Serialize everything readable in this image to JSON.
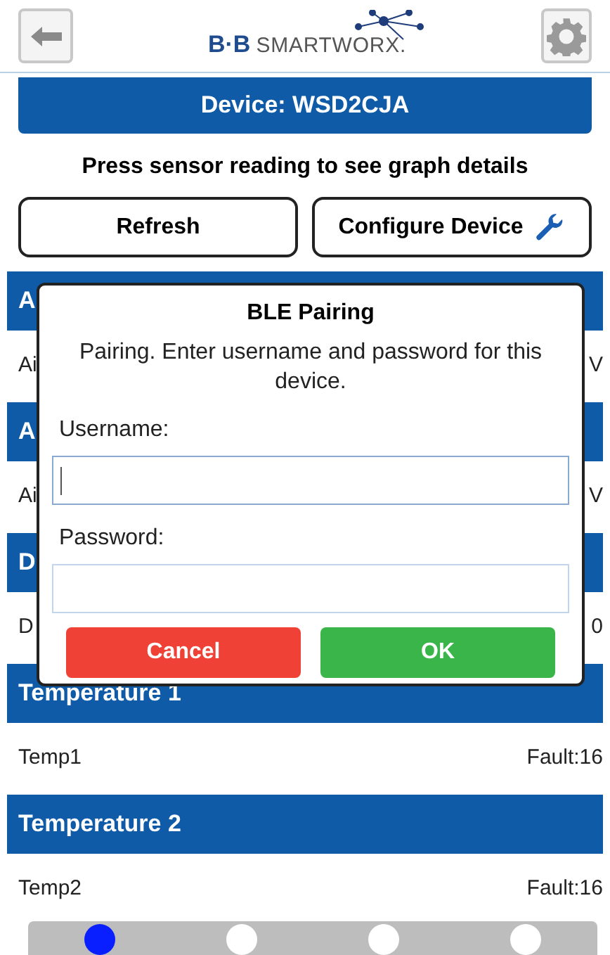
{
  "header": {
    "logo_mark": "B·B",
    "logo_name": "SMARTWORX."
  },
  "device_bar": {
    "title": "Device: WSD2CJA"
  },
  "instruction": "Press sensor reading to see graph details",
  "buttons": [
    {
      "label": "Refresh",
      "icon": false
    },
    {
      "label": "Configure Device",
      "icon": true
    }
  ],
  "sections": [
    {
      "title": "A",
      "row_label": "Ai",
      "row_value": "V"
    },
    {
      "title": "A",
      "row_label": "Ai",
      "row_value": "V"
    },
    {
      "title": "D",
      "row_label": "D",
      "row_value": "0"
    },
    {
      "title": "Temperature 1",
      "row_label": "Temp1",
      "row_value": "Fault:16"
    },
    {
      "title": "Temperature 2",
      "row_label": "Temp2",
      "row_value": "Fault:16"
    }
  ],
  "pager": [
    {
      "selected": true
    },
    {
      "selected": false
    },
    {
      "selected": false
    },
    {
      "selected": false
    }
  ],
  "dialog": {
    "title": "BLE Pairing",
    "message": "Pairing. Enter username and password for this device.",
    "fields": [
      {
        "label": "Username:",
        "focused": true
      },
      {
        "label": "Password:",
        "focused": false
      }
    ],
    "buttons": [
      {
        "label": "Cancel",
        "kind": "cancel"
      },
      {
        "label": "OK",
        "kind": "ok"
      }
    ]
  }
}
